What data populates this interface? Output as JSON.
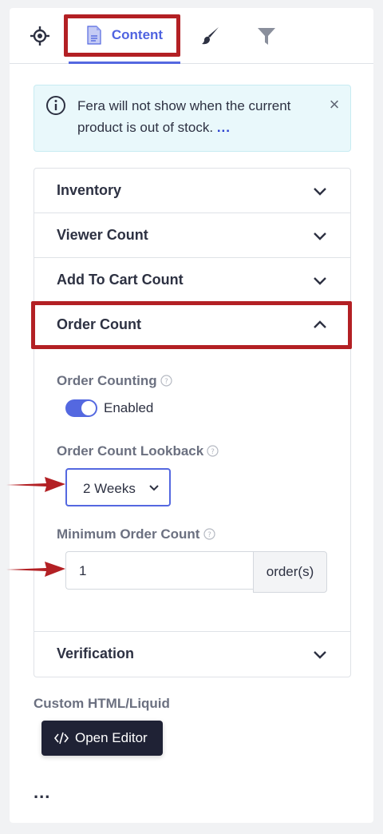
{
  "tabs": {
    "active_label": "Content",
    "icons": [
      "target-icon",
      "document-icon",
      "brush-icon",
      "filter-icon"
    ]
  },
  "notice": {
    "text": "Fera will not show when the current product is out of stock.",
    "more": "...",
    "close": "×"
  },
  "sections": {
    "inventory": "Inventory",
    "viewer_count": "Viewer Count",
    "add_to_cart": "Add To Cart Count",
    "order_count": "Order Count",
    "verification": "Verification"
  },
  "order_count": {
    "counting_label": "Order Counting",
    "toggle_label": "Enabled",
    "toggle_enabled": true,
    "lookback_label": "Order Count Lookback",
    "lookback_value": "2 Weeks",
    "minimum_label": "Minimum Order Count",
    "minimum_value": "1",
    "minimum_unit": "order(s)"
  },
  "custom": {
    "label": "Custom HTML/Liquid",
    "button_label": "Open Editor"
  },
  "footer": {
    "more_dots": "..."
  },
  "colors": {
    "accent": "#5468e0",
    "highlight": "#b32024",
    "dark_button": "#1f2235"
  }
}
